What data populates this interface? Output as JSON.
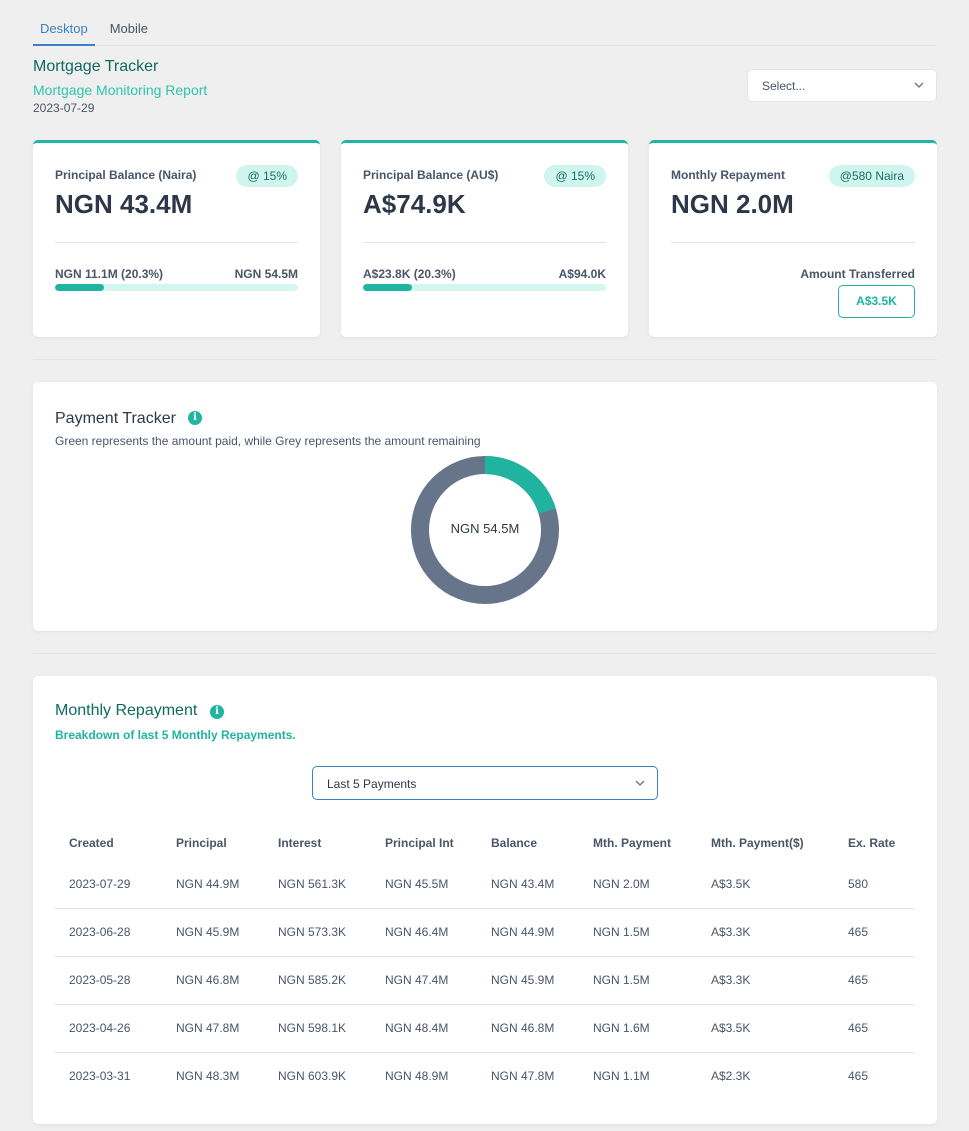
{
  "tabs": [
    {
      "label": "Desktop"
    },
    {
      "label": "Mobile"
    }
  ],
  "header": {
    "title": "Mortgage Tracker",
    "subtitle": "Mortgage Monitoring Report",
    "date": "2023-07-29",
    "select_placeholder": "Select..."
  },
  "cards": [
    {
      "label": "Principal Balance (Naira)",
      "badge": "@ 15%",
      "value": "NGN 43.4M",
      "left_text": "NGN 11.1M (20.3%)",
      "right_text": "NGN 54.5M",
      "progress": 0.203
    },
    {
      "label": "Principal Balance (AU$)",
      "badge": "@ 15%",
      "value": "A$74.9K",
      "left_text": "A$23.8K (20.3%)",
      "right_text": "A$94.0K",
      "progress": 0.203
    },
    {
      "label": "Monthly Repayment",
      "badge": "@580 Naira",
      "value": "NGN 2.0M",
      "transfer_label": "Amount Transferred",
      "transfer_value": "A$3.5K"
    }
  ],
  "payment_tracker": {
    "title": "Payment Tracker",
    "description": "Green represents the amount paid, while Grey represents the amount remaining",
    "center_label": "NGN 54.5M",
    "paid_fraction": 0.203,
    "paid_color": "#20b3a0",
    "remaining_color": "#66758a"
  },
  "monthly_repayment": {
    "title": "Monthly Repayment",
    "subtitle": "Breakdown of last 5 Monthly Repayments.",
    "select_value": "Last 5 Payments",
    "columns": [
      "Created",
      "Principal",
      "Interest",
      "Principal Int",
      "Balance",
      "Mth. Payment",
      "Mth. Payment($)",
      "Ex. Rate"
    ],
    "rows": [
      [
        "2023-07-29",
        "NGN 44.9M",
        "NGN 561.3K",
        "NGN 45.5M",
        "NGN 43.4M",
        "NGN 2.0M",
        "A$3.5K",
        "580"
      ],
      [
        "2023-06-28",
        "NGN 45.9M",
        "NGN 573.3K",
        "NGN 46.4M",
        "NGN 44.9M",
        "NGN 1.5M",
        "A$3.3K",
        "465"
      ],
      [
        "2023-05-28",
        "NGN 46.8M",
        "NGN 585.2K",
        "NGN 47.4M",
        "NGN 45.9M",
        "NGN 1.5M",
        "A$3.3K",
        "465"
      ],
      [
        "2023-04-26",
        "NGN 47.8M",
        "NGN 598.1K",
        "NGN 48.4M",
        "NGN 46.8M",
        "NGN 1.6M",
        "A$3.5K",
        "465"
      ],
      [
        "2023-03-31",
        "NGN 48.3M",
        "NGN 603.9K",
        "NGN 48.9M",
        "NGN 47.8M",
        "NGN 1.1M",
        "A$2.3K",
        "465"
      ]
    ]
  },
  "accent_color": "#1fb5a1"
}
